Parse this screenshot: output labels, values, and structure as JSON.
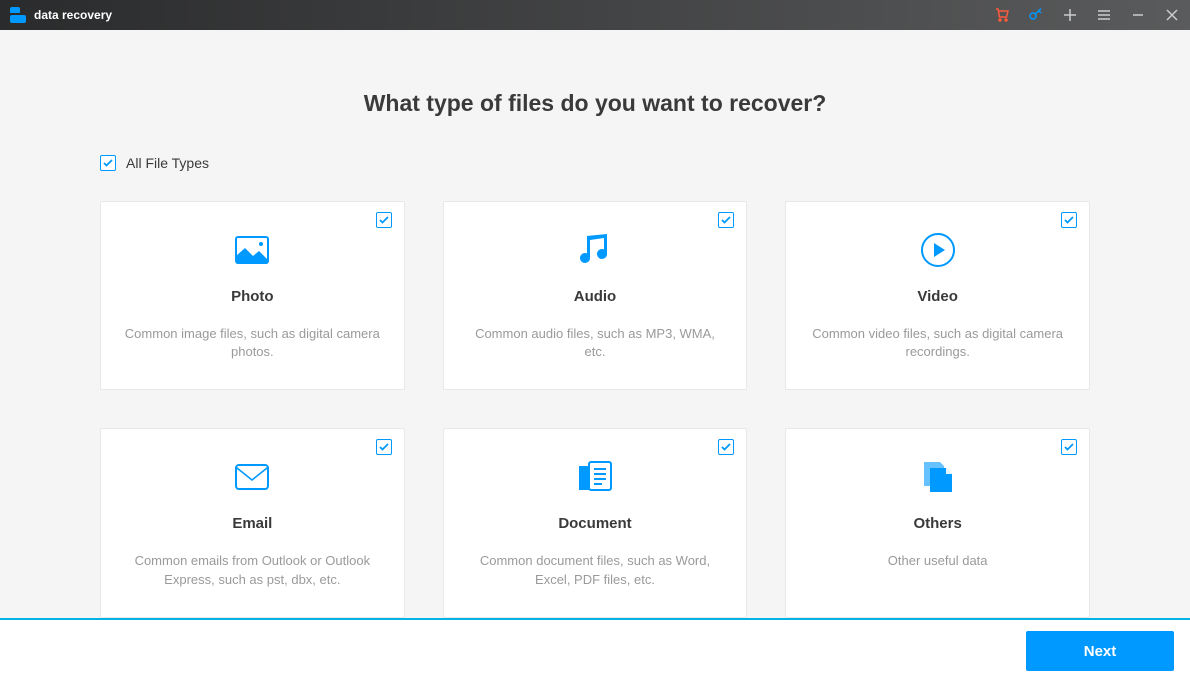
{
  "titlebar": {
    "app_title": "data recovery"
  },
  "page": {
    "title": "What type of files do you want to recover?"
  },
  "all_files": {
    "label": "All File Types",
    "checked": true
  },
  "cards": [
    {
      "title": "Photo",
      "desc": "Common image files, such as digital camera photos.",
      "checked": true,
      "icon": "image-icon"
    },
    {
      "title": "Audio",
      "desc": "Common audio files, such as MP3, WMA, etc.",
      "checked": true,
      "icon": "audio-icon"
    },
    {
      "title": "Video",
      "desc": "Common video files, such as digital camera recordings.",
      "checked": true,
      "icon": "video-icon"
    },
    {
      "title": "Email",
      "desc": "Common emails from Outlook or Outlook Express, such as pst, dbx, etc.",
      "checked": true,
      "icon": "email-icon"
    },
    {
      "title": "Document",
      "desc": "Common document files, such as Word, Excel, PDF files, etc.",
      "checked": true,
      "icon": "document-icon"
    },
    {
      "title": "Others",
      "desc": "Other useful data",
      "checked": true,
      "icon": "files-icon"
    }
  ],
  "footer": {
    "next_label": "Next"
  },
  "colors": {
    "accent": "#0099ff"
  }
}
